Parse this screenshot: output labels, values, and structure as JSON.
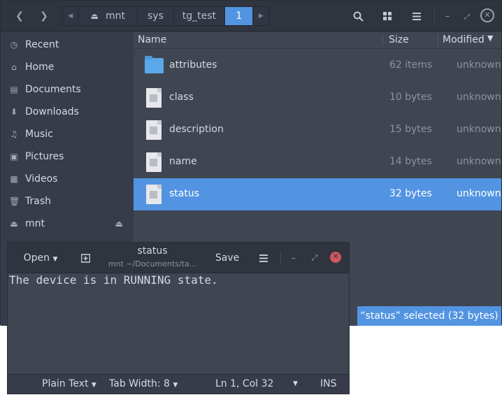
{
  "files": {
    "path": [
      "mnt",
      "sys",
      "tg_test",
      "1"
    ],
    "sidebar": [
      {
        "label": "Recent",
        "icon": "clock-icon"
      },
      {
        "label": "Home",
        "icon": "home-icon"
      },
      {
        "label": "Documents",
        "icon": "document-icon"
      },
      {
        "label": "Downloads",
        "icon": "download-icon"
      },
      {
        "label": "Music",
        "icon": "music-icon"
      },
      {
        "label": "Pictures",
        "icon": "pictures-icon"
      },
      {
        "label": "Videos",
        "icon": "video-icon"
      },
      {
        "label": "Trash",
        "icon": "trash-icon"
      },
      {
        "label": "mnt",
        "icon": "eject-drive-icon"
      }
    ],
    "columns": {
      "name": "Name",
      "size": "Size",
      "modified": "Modified"
    },
    "rows": [
      {
        "name": "attributes",
        "size": "62 items",
        "modified": "unknown",
        "type": "folder"
      },
      {
        "name": "class",
        "size": "10 bytes",
        "modified": "unknown",
        "type": "file"
      },
      {
        "name": "description",
        "size": "15 bytes",
        "modified": "unknown",
        "type": "file"
      },
      {
        "name": "name",
        "size": "14 bytes",
        "modified": "unknown",
        "type": "file"
      },
      {
        "name": "status",
        "size": "32 bytes",
        "modified": "unknown",
        "type": "file",
        "selected": true
      }
    ],
    "status": "“status” selected  (32 bytes)",
    "accent": "#5294e2"
  },
  "editor": {
    "open_label": "Open",
    "title": "status",
    "subtitle": "mnt ~/Documents/ta...",
    "save_label": "Save",
    "content": "The device is in RUNNING state.",
    "footer": {
      "language": "Plain Text",
      "tab_width": "Tab Width: 8",
      "position": "Ln 1, Col 32",
      "mode": "INS"
    }
  }
}
